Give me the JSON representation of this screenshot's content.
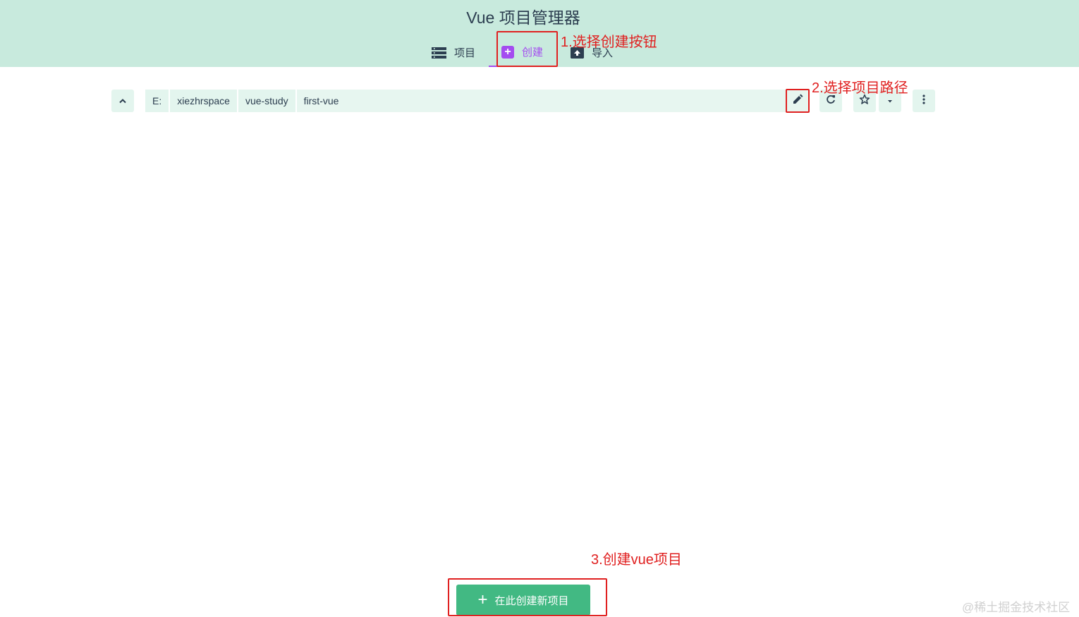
{
  "header": {
    "title": "Vue 项目管理器",
    "tabs": [
      {
        "label": "项目",
        "icon": "list-icon"
      },
      {
        "label": "创建",
        "icon": "add-box-icon",
        "active": true
      },
      {
        "label": "导入",
        "icon": "unarchive-icon"
      }
    ]
  },
  "folder_explorer": {
    "crumbs": [
      "E:",
      "xiezhrspace",
      "vue-study",
      "first-vue"
    ],
    "actions": [
      "up-arrow-icon",
      "edit-icon",
      "refresh-icon",
      "star-icon",
      "caret-down-icon",
      "more-vert-icon"
    ]
  },
  "create_button": {
    "label": "在此创建新项目",
    "icon": "plus-icon"
  },
  "annotations": {
    "step1": "1.选择创建按钮",
    "step2": "2.选择项目路径",
    "step3": "3.创建vue项目"
  },
  "watermark": "@稀土掘金技术社区",
  "colors": {
    "header_bg": "#c8eadd",
    "accent_purple": "#a44cf0",
    "primary_green": "#42b983",
    "annotation_red": "#e02020",
    "text_dark": "#2c3e50"
  }
}
